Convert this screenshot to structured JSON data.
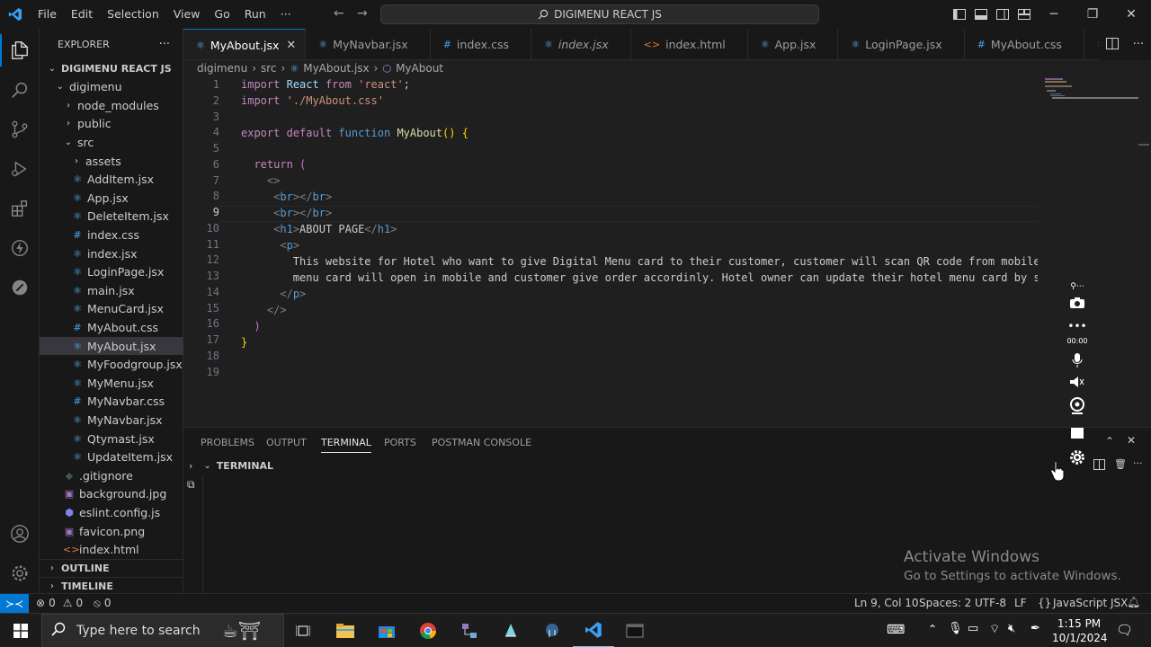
{
  "titlebar": {
    "menus": [
      "File",
      "Edit",
      "Selection",
      "View",
      "Go",
      "Run"
    ],
    "more": "···",
    "search_text": "DIGIMENU REACT JS"
  },
  "explorer": {
    "title": "EXPLORER",
    "more": "···",
    "root": "DIGIMENU REACT JS",
    "tree": [
      {
        "label": "digimenu",
        "type": "folder-open",
        "depth": 1
      },
      {
        "label": "node_modules",
        "type": "folder",
        "depth": 2
      },
      {
        "label": "public",
        "type": "folder",
        "depth": 2
      },
      {
        "label": "src",
        "type": "folder-open",
        "depth": 2
      },
      {
        "label": "assets",
        "type": "folder",
        "depth": 3
      },
      {
        "label": "AddItem.jsx",
        "type": "jsx",
        "depth": 3
      },
      {
        "label": "App.jsx",
        "type": "jsx",
        "depth": 3
      },
      {
        "label": "DeleteItem.jsx",
        "type": "jsx",
        "depth": 3
      },
      {
        "label": "index.css",
        "type": "css",
        "depth": 3
      },
      {
        "label": "index.jsx",
        "type": "jsx",
        "depth": 3
      },
      {
        "label": "LoginPage.jsx",
        "type": "jsx",
        "depth": 3
      },
      {
        "label": "main.jsx",
        "type": "jsx",
        "depth": 3
      },
      {
        "label": "MenuCard.jsx",
        "type": "jsx",
        "depth": 3
      },
      {
        "label": "MyAbout.css",
        "type": "css",
        "depth": 3
      },
      {
        "label": "MyAbout.jsx",
        "type": "jsx",
        "depth": 3,
        "selected": true
      },
      {
        "label": "MyFoodgroup.jsx",
        "type": "jsx",
        "depth": 3
      },
      {
        "label": "MyMenu.jsx",
        "type": "jsx",
        "depth": 3
      },
      {
        "label": "MyNavbar.css",
        "type": "css",
        "depth": 3
      },
      {
        "label": "MyNavbar.jsx",
        "type": "jsx",
        "depth": 3
      },
      {
        "label": "Qtymast.jsx",
        "type": "jsx",
        "depth": 3
      },
      {
        "label": "UpdateItem.jsx",
        "type": "jsx",
        "depth": 3
      },
      {
        "label": ".gitignore",
        "type": "git",
        "depth": 2
      },
      {
        "label": "background.jpg",
        "type": "img",
        "depth": 2
      },
      {
        "label": "eslint.config.js",
        "type": "eslint",
        "depth": 2
      },
      {
        "label": "favicon.png",
        "type": "img",
        "depth": 2
      },
      {
        "label": "index.html",
        "type": "html",
        "depth": 2
      }
    ],
    "outline": "OUTLINE",
    "timeline": "TIMELINE"
  },
  "tabs": [
    {
      "label": "MyAbout.jsx",
      "type": "jsx",
      "active": true,
      "close": "✕"
    },
    {
      "label": "MyNavbar.jsx",
      "type": "jsx"
    },
    {
      "label": "index.css",
      "type": "css"
    },
    {
      "label": "index.jsx",
      "type": "jsx",
      "italic": true
    },
    {
      "label": "index.html",
      "type": "html"
    },
    {
      "label": "App.jsx",
      "type": "jsx"
    },
    {
      "label": "LoginPage.jsx",
      "type": "jsx"
    },
    {
      "label": "MyAbout.css",
      "type": "css"
    },
    {
      "label": "MyN",
      "type": "jsx"
    }
  ],
  "breadcrumb": [
    "digimenu",
    "src",
    "MyAbout.jsx",
    "MyAbout"
  ],
  "editor": {
    "line_numbers": [
      "1",
      "2",
      "3",
      "4",
      "5",
      "6",
      "7",
      "8",
      "9",
      "10",
      "11",
      "12",
      "13",
      "14",
      "15",
      "16",
      "17",
      "18",
      "19"
    ],
    "current_line": "9"
  },
  "panel": {
    "tabs": [
      "PROBLEMS",
      "OUTPUT",
      "TERMINAL",
      "PORTS",
      "POSTMAN CONSOLE"
    ],
    "active_tab": "TERMINAL",
    "terminal_header": "TERMINAL"
  },
  "statusbar": {
    "errors": "0",
    "warnings": "0",
    "ports": "0",
    "position": "Ln 9, Col 10",
    "spaces": "Spaces: 2",
    "encoding": "UTF-8",
    "eol": "LF",
    "language": "JavaScript JSX"
  },
  "watermark": {
    "title": "Activate Windows",
    "subtitle": "Go to Settings to activate Windows."
  },
  "gamebar": {
    "timer": "00:00"
  },
  "taskbar": {
    "search_placeholder": "Type here to search",
    "time": "1:15 PM",
    "date": "10/1/2024"
  },
  "colors": {
    "accent": "#0078d4",
    "background": "#1f1f1f",
    "sidebar": "#181818"
  }
}
